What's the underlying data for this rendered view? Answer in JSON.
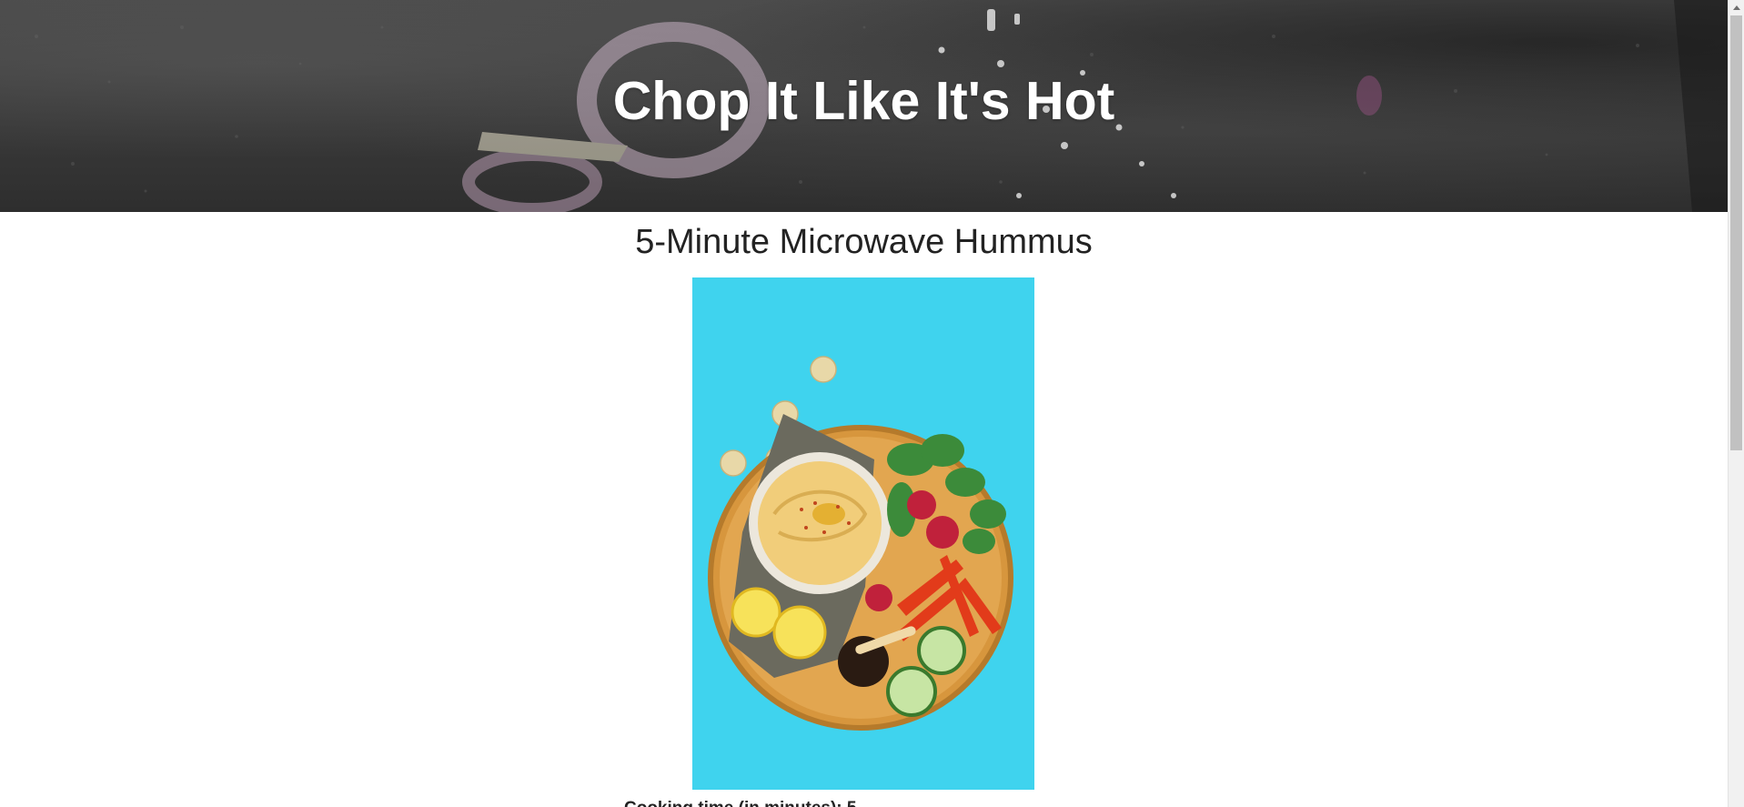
{
  "header": {
    "site_title": "Chop It Like It's Hot"
  },
  "recipe": {
    "title": "5-Minute Microwave Hummus",
    "image_alt": "Hummus platter with vegetables and crackers",
    "next_line": "Cooking time (in minutes): 5"
  },
  "icons": {
    "scroll_up": "scroll-up-arrow-icon"
  },
  "colors": {
    "photo_background": "#3fd3ee",
    "title_text": "#222222",
    "hero_text": "#ffffff"
  }
}
